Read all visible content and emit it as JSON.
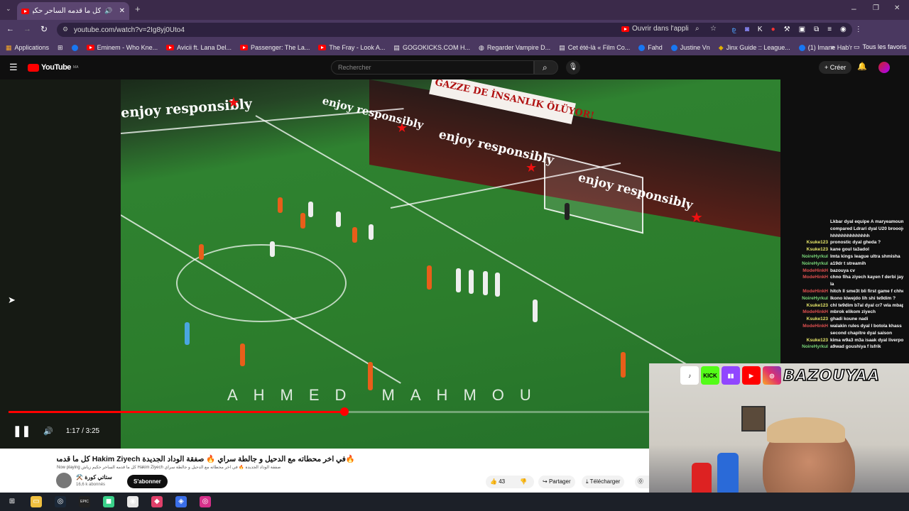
{
  "browser": {
    "tab_title": "كل ما قدمه الساحر حكيم زياش",
    "url": "youtube.com/watch?v=2Ig8yj0Uto4",
    "open_in_app": "Ouvrir dans l'appli",
    "bookmarks": [
      "Applications",
      "Eminem - Who Kne...",
      "Avicii ft. Lana Del...",
      "Passenger: The La...",
      "The Fray - Look A...",
      "GOGOKICKS.COM H...",
      "Regarder Vampire D...",
      "Cet été-là « Film Co...",
      "Fahd",
      "Justine Vn",
      "Jinx Guide :: League...",
      "(1) Imane Hab'r"
    ],
    "all_bookmarks": "Tous les favoris"
  },
  "youtube": {
    "logo": "YouTube",
    "region": "MA",
    "search_placeholder": "Rechercher",
    "create_label": "Créer"
  },
  "video": {
    "overlay_text": "AHMED MAHMOU",
    "board_text": "enjoy responsibly",
    "banner_text": "GAZZE DE İNSANLIK ÖLÜYOR!",
    "time": "1:17 / 3:25",
    "progress_fraction": 0.524
  },
  "info": {
    "title": "🔥في اخر محطاته مع الدحيل و جالطة سراي 🔥 صفقة الوداد الجديدة Hakim Ziyech كل ما قدمه الساحر حكيم زياش",
    "now_playing": "Now playing كل ما قدمه الساحر حكيم زياش Hakim Ziyech صفقة الوداد الجديدة 🔥 في اخر محطاته مع الدحيل و جالطة سراي",
    "channel": "⚒️ ستاتي كورة",
    "subscribers": "16,6 k abonnés",
    "subscribe": "S'abonner",
    "likes": "43",
    "share": "Partager",
    "download": "Télécharger"
  },
  "chat": [
    {
      "user": "",
      "msg": "Lkbar dyal equipe A maryeamoumcn",
      "color": "#ffffff"
    },
    {
      "user": "",
      "msg": "compared Ldrari dyal U20 brooojola",
      "color": "#ffffff"
    },
    {
      "user": "",
      "msg": "hhhhhhhhhhhhhh",
      "color": "#ffffff"
    },
    {
      "user": "Ksuke123",
      "msg": "pronostic dyal gheda ?",
      "color": "#e8e86a"
    },
    {
      "user": "Ksuke123",
      "msg": "kane goul ta3adol",
      "color": "#e8e86a"
    },
    {
      "user": "NoireHyrkul",
      "msg": "lmta kings league ultra shmisha",
      "color": "#7ad97a"
    },
    {
      "user": "NoireHyrkul",
      "msg": "a19dr t streamih",
      "color": "#7ad97a"
    },
    {
      "user": "ModeHinkH",
      "msg": "bazouya cv",
      "color": "#e05050"
    },
    {
      "user": "ModeHinkH",
      "msg": "chno fiha ziyech kayen f derbi jay wl",
      "color": "#e05050"
    },
    {
      "user": "",
      "msg": "la",
      "color": "#ffffff"
    },
    {
      "user": "ModeHinkH",
      "msg": "hitch ll sme3t bli first game f chher 1",
      "color": "#e05050"
    },
    {
      "user": "NoireHyrkul",
      "msg": "lkono kiwejdo lih shi te9dim ?",
      "color": "#7ad97a"
    },
    {
      "user": "Ksuke123",
      "msg": "chl te9dim b7al dyal cr7 wla mbappe",
      "color": "#e8e86a"
    },
    {
      "user": "ModeHinkH",
      "msg": "mbrok elikom ziyech",
      "color": "#e05050"
    },
    {
      "user": "Ksuke123",
      "msg": "ghadi koune nadi",
      "color": "#e8e86a"
    },
    {
      "user": "ModeHinkH",
      "msg": "walakin rules dyal l botola khass hta",
      "color": "#e05050"
    },
    {
      "user": "",
      "msg": "second chapitre dyal saison",
      "color": "#ffffff"
    },
    {
      "user": "Ksuke123",
      "msg": "kima w9a3 m3a isaak dyal liverpool",
      "color": "#e8e86a"
    },
    {
      "user": "NoireHyrkul",
      "msg": "a9wad goushiya f lsfrik",
      "color": "#7ad97a"
    }
  ],
  "overlay": {
    "brand": "BAZOUYAA",
    "platforms": [
      "tiktok-icon",
      "kick-icon",
      "twitch-icon",
      "youtube-icon",
      "instagram-icon"
    ]
  },
  "taskbar": {
    "icons": [
      "windows-start-icon",
      "file-explorer-icon",
      "steam-icon",
      "epic-games-icon",
      "app-icon",
      "chrome-icon",
      "game-icon",
      "browser-icon",
      "instagram-icon"
    ]
  },
  "colors": {
    "accent": "#ff0000",
    "browser_chrome": "#4a3860"
  }
}
